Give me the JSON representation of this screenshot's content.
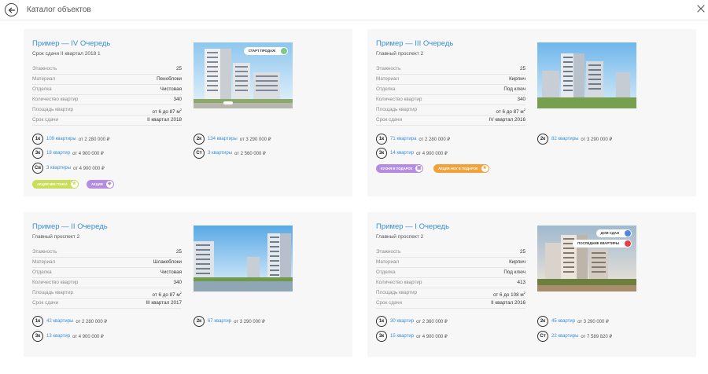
{
  "header": {
    "title": "Каталог объектов"
  },
  "spec_labels": [
    "Этажность",
    "Материал",
    "Отделка",
    "Количество квартир",
    "Площадь квартир",
    "Срок сдачи"
  ],
  "cards": [
    {
      "title": "Пример — IV Очередь",
      "subtitle": "Срок сдачи II квартал 2018 1",
      "specs": [
        "25",
        "Пеноблоки",
        "Чистовая",
        "340",
        "от 6 до 87 м",
        "II квартал 2018"
      ],
      "tags": [
        {
          "label": "СТАРТ ПРОДАЖ",
          "color": "#7fc98f"
        }
      ],
      "apartments": [
        {
          "badge": "1к",
          "count": "109 квартиры",
          "price": "от 2 280 000 ₽"
        },
        {
          "badge": "2к",
          "count": "134 квартиры",
          "price": "от 3 290 000 ₽"
        },
        {
          "badge": "3к",
          "count": "18 квартир",
          "price": "от 4 900 000 ₽"
        },
        {
          "badge": "Ст",
          "count": "3 квартиры",
          "price": "от 2 560 000 ₽"
        },
        {
          "badge": "Св",
          "count": "3 квартиры",
          "price": "от 4 900 000 ₽"
        }
      ],
      "promos": [
        {
          "label": "АКЦИЯ MIN ГОНКА",
          "color": "#c9dd59",
          "icon": "★"
        },
        {
          "label": "АКЦИЯ",
          "color": "#b48de0",
          "icon": "◆"
        }
      ]
    },
    {
      "title": "Пример — III Очередь",
      "subtitle": "Главный проспект 2",
      "specs": [
        "25",
        "Кирпич",
        "Под ключ",
        "340",
        "от 6 до 87 м",
        "IV квартал 2016"
      ],
      "tags": [],
      "apartments": [
        {
          "badge": "1к",
          "count": "71 квартира",
          "price": "от 2 280 000 ₽"
        },
        {
          "badge": "2к",
          "count": "82 квартиры",
          "price": "от 3 290 000 ₽"
        },
        {
          "badge": "3к",
          "count": "14 квартир",
          "price": "от 4 900 000 ₽"
        }
      ],
      "promos": [
        {
          "label": "КУХНЯ В ПОДАРОК",
          "color": "#b48de0",
          "icon": "▣"
        },
        {
          "label": "АКЦИЯ НОУ В ПОДАРОК",
          "color": "#f3a13b",
          "icon": "★"
        }
      ]
    },
    {
      "title": "Пример — II Очередь",
      "subtitle": "Главный проспект 2",
      "specs": [
        "25",
        "Шлакоблоки",
        "Чистовая",
        "340",
        "от 6 до 87 м",
        "III квартал 2017"
      ],
      "tags": [],
      "apartments": [
        {
          "badge": "1к",
          "count": "42 квартиры",
          "price": "от 2 280 000 ₽"
        },
        {
          "badge": "2к",
          "count": "67 квартир",
          "price": "от 3 290 000 ₽"
        },
        {
          "badge": "3к",
          "count": "13 квартир",
          "price": "от 4 900 000 ₽"
        }
      ],
      "promos": []
    },
    {
      "title": "Пример — I Очередь",
      "subtitle": "Главный проспект 2",
      "specs": [
        "25",
        "Кирпич",
        "Под ключ",
        "413",
        "от 6 до 108 м",
        "II квартал 2016"
      ],
      "tags": [
        {
          "label": "ДОМ СДАН",
          "color": "#4f86e0"
        },
        {
          "label": "ПОСЛЕДНИЕ КВАРТИРЫ",
          "color": "#e0434a"
        }
      ],
      "apartments": [
        {
          "badge": "1к",
          "count": "30 квартир",
          "price": "от 2 360 000 ₽"
        },
        {
          "badge": "2к",
          "count": "45 квартир",
          "price": "от 3 290 000 ₽"
        },
        {
          "badge": "3к",
          "count": "15 квартир",
          "price": "от 4 900 000 ₽"
        },
        {
          "badge": "Ст",
          "count": "22 квартиры",
          "price": "от 7 589 820 ₽"
        }
      ],
      "promos": []
    }
  ]
}
